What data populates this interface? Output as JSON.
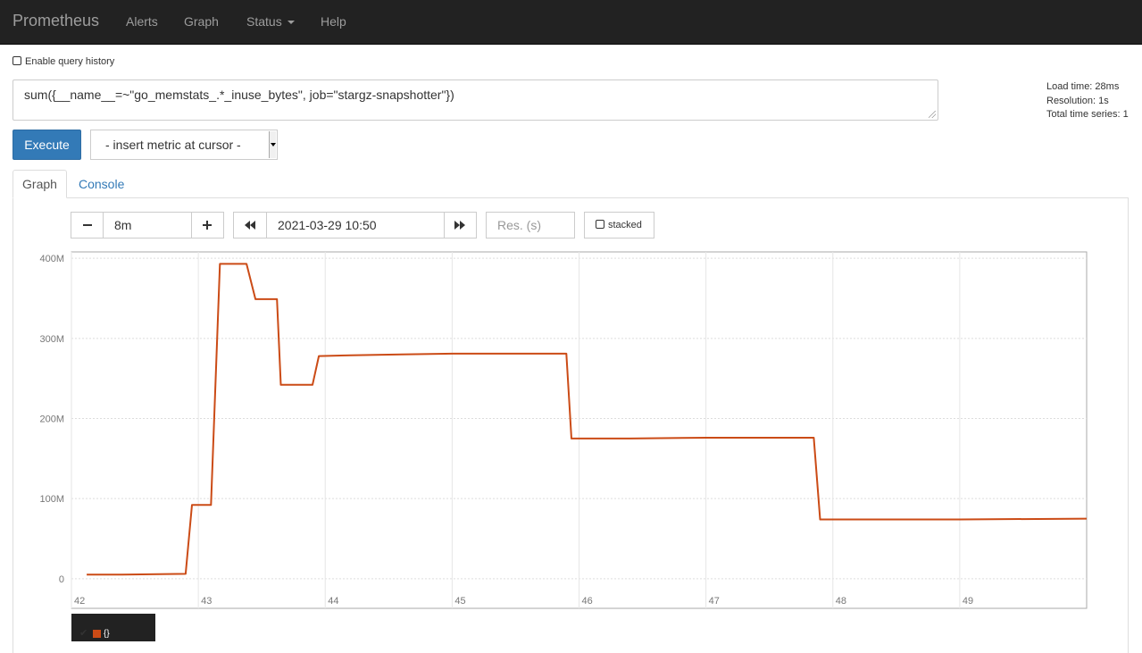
{
  "navbar": {
    "brand": "Prometheus",
    "items": [
      "Alerts",
      "Graph",
      "Status",
      "Help"
    ]
  },
  "history": {
    "label": "Enable query history",
    "checked": false
  },
  "query": {
    "expression": "sum({__name__=~\"go_memstats_.*_inuse_bytes\", job=\"stargz-snapshotter\"})"
  },
  "stats": {
    "load_time": "Load time: 28ms",
    "resolution": "Resolution: 1s",
    "total_series": "Total time series: 1"
  },
  "execute_label": "Execute",
  "metric_select": {
    "value": "- insert metric at cursor -"
  },
  "tabs": {
    "graph": "Graph",
    "console": "Console",
    "active": "graph"
  },
  "controls": {
    "range": "8m",
    "end_time": "2021-03-29 10:50",
    "resolution_placeholder": "Res. (s)",
    "stacked_label": "stacked",
    "stacked_checked": false
  },
  "colors": {
    "series": "#cb4b16",
    "accent": "#337ab7",
    "navbar": "#222222"
  },
  "icons": [
    "caret-down-icon",
    "minus-icon",
    "plus-icon",
    "backward-icon",
    "forward-icon",
    "checkbox-icon",
    "check-icon",
    "resize-handle-icon"
  ],
  "chart_data": {
    "type": "line",
    "x_ticks": [
      "42",
      "43",
      "44",
      "45",
      "46",
      "47",
      "48",
      "49"
    ],
    "y_ticks": [
      "0",
      "100M",
      "200M",
      "300M",
      "400M"
    ],
    "xlim": [
      42,
      50
    ],
    "ylim": [
      -37,
      408
    ],
    "grid": true,
    "legend": "bottom-left",
    "series": [
      {
        "name": "{}",
        "color": "#cb4b16",
        "points": [
          [
            42.12,
            5
          ],
          [
            42.4,
            5
          ],
          [
            42.9,
            6
          ],
          [
            42.95,
            92
          ],
          [
            43.1,
            92
          ],
          [
            43.17,
            393
          ],
          [
            43.38,
            393
          ],
          [
            43.45,
            349
          ],
          [
            43.62,
            349
          ],
          [
            43.65,
            242
          ],
          [
            43.9,
            242
          ],
          [
            43.95,
            278
          ],
          [
            44.2,
            279
          ],
          [
            44.6,
            280
          ],
          [
            45.0,
            281
          ],
          [
            45.9,
            281
          ],
          [
            45.94,
            175
          ],
          [
            46.4,
            175
          ],
          [
            47.0,
            176
          ],
          [
            47.85,
            176
          ],
          [
            47.9,
            74
          ],
          [
            48.5,
            74
          ],
          [
            49.0,
            74
          ],
          [
            50.0,
            75
          ]
        ]
      }
    ]
  }
}
